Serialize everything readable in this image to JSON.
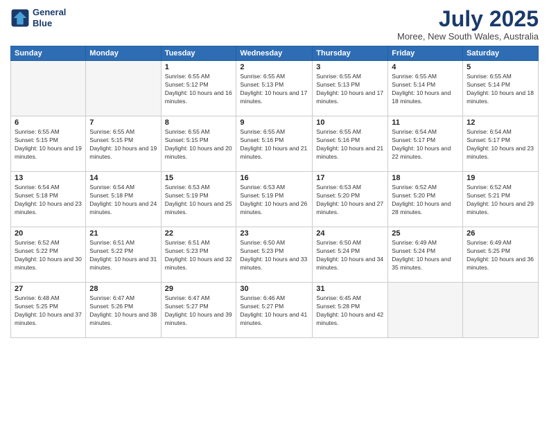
{
  "logo": {
    "line1": "General",
    "line2": "Blue"
  },
  "title": "July 2025",
  "subtitle": "Moree, New South Wales, Australia",
  "weekdays": [
    "Sunday",
    "Monday",
    "Tuesday",
    "Wednesday",
    "Thursday",
    "Friday",
    "Saturday"
  ],
  "weeks": [
    [
      {
        "day": "",
        "empty": true
      },
      {
        "day": "",
        "empty": true
      },
      {
        "day": "1",
        "sunrise": "6:55 AM",
        "sunset": "5:12 PM",
        "daylight": "10 hours and 16 minutes."
      },
      {
        "day": "2",
        "sunrise": "6:55 AM",
        "sunset": "5:13 PM",
        "daylight": "10 hours and 17 minutes."
      },
      {
        "day": "3",
        "sunrise": "6:55 AM",
        "sunset": "5:13 PM",
        "daylight": "10 hours and 17 minutes."
      },
      {
        "day": "4",
        "sunrise": "6:55 AM",
        "sunset": "5:14 PM",
        "daylight": "10 hours and 18 minutes."
      },
      {
        "day": "5",
        "sunrise": "6:55 AM",
        "sunset": "5:14 PM",
        "daylight": "10 hours and 18 minutes."
      }
    ],
    [
      {
        "day": "6",
        "sunrise": "6:55 AM",
        "sunset": "5:15 PM",
        "daylight": "10 hours and 19 minutes."
      },
      {
        "day": "7",
        "sunrise": "6:55 AM",
        "sunset": "5:15 PM",
        "daylight": "10 hours and 19 minutes."
      },
      {
        "day": "8",
        "sunrise": "6:55 AM",
        "sunset": "5:15 PM",
        "daylight": "10 hours and 20 minutes."
      },
      {
        "day": "9",
        "sunrise": "6:55 AM",
        "sunset": "5:16 PM",
        "daylight": "10 hours and 21 minutes."
      },
      {
        "day": "10",
        "sunrise": "6:55 AM",
        "sunset": "5:16 PM",
        "daylight": "10 hours and 21 minutes."
      },
      {
        "day": "11",
        "sunrise": "6:54 AM",
        "sunset": "5:17 PM",
        "daylight": "10 hours and 22 minutes."
      },
      {
        "day": "12",
        "sunrise": "6:54 AM",
        "sunset": "5:17 PM",
        "daylight": "10 hours and 23 minutes."
      }
    ],
    [
      {
        "day": "13",
        "sunrise": "6:54 AM",
        "sunset": "5:18 PM",
        "daylight": "10 hours and 23 minutes."
      },
      {
        "day": "14",
        "sunrise": "6:54 AM",
        "sunset": "5:18 PM",
        "daylight": "10 hours and 24 minutes."
      },
      {
        "day": "15",
        "sunrise": "6:53 AM",
        "sunset": "5:19 PM",
        "daylight": "10 hours and 25 minutes."
      },
      {
        "day": "16",
        "sunrise": "6:53 AM",
        "sunset": "5:19 PM",
        "daylight": "10 hours and 26 minutes."
      },
      {
        "day": "17",
        "sunrise": "6:53 AM",
        "sunset": "5:20 PM",
        "daylight": "10 hours and 27 minutes."
      },
      {
        "day": "18",
        "sunrise": "6:52 AM",
        "sunset": "5:20 PM",
        "daylight": "10 hours and 28 minutes."
      },
      {
        "day": "19",
        "sunrise": "6:52 AM",
        "sunset": "5:21 PM",
        "daylight": "10 hours and 29 minutes."
      }
    ],
    [
      {
        "day": "20",
        "sunrise": "6:52 AM",
        "sunset": "5:22 PM",
        "daylight": "10 hours and 30 minutes."
      },
      {
        "day": "21",
        "sunrise": "6:51 AM",
        "sunset": "5:22 PM",
        "daylight": "10 hours and 31 minutes."
      },
      {
        "day": "22",
        "sunrise": "6:51 AM",
        "sunset": "5:23 PM",
        "daylight": "10 hours and 32 minutes."
      },
      {
        "day": "23",
        "sunrise": "6:50 AM",
        "sunset": "5:23 PM",
        "daylight": "10 hours and 33 minutes."
      },
      {
        "day": "24",
        "sunrise": "6:50 AM",
        "sunset": "5:24 PM",
        "daylight": "10 hours and 34 minutes."
      },
      {
        "day": "25",
        "sunrise": "6:49 AM",
        "sunset": "5:24 PM",
        "daylight": "10 hours and 35 minutes."
      },
      {
        "day": "26",
        "sunrise": "6:49 AM",
        "sunset": "5:25 PM",
        "daylight": "10 hours and 36 minutes."
      }
    ],
    [
      {
        "day": "27",
        "sunrise": "6:48 AM",
        "sunset": "5:25 PM",
        "daylight": "10 hours and 37 minutes."
      },
      {
        "day": "28",
        "sunrise": "6:47 AM",
        "sunset": "5:26 PM",
        "daylight": "10 hours and 38 minutes."
      },
      {
        "day": "29",
        "sunrise": "6:47 AM",
        "sunset": "5:27 PM",
        "daylight": "10 hours and 39 minutes."
      },
      {
        "day": "30",
        "sunrise": "6:46 AM",
        "sunset": "5:27 PM",
        "daylight": "10 hours and 41 minutes."
      },
      {
        "day": "31",
        "sunrise": "6:45 AM",
        "sunset": "5:28 PM",
        "daylight": "10 hours and 42 minutes."
      },
      {
        "day": "",
        "empty": true
      },
      {
        "day": "",
        "empty": true
      }
    ]
  ]
}
